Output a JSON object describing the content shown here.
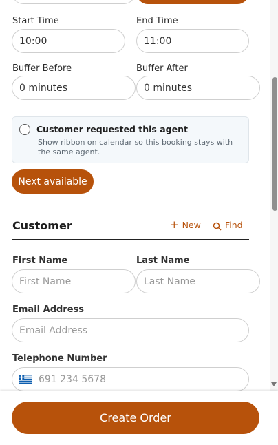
{
  "schedule": {
    "start_time": {
      "label": "Start Time",
      "value": "10:00"
    },
    "end_time": {
      "label": "End Time",
      "value": "11:00"
    },
    "buffer_before": {
      "label": "Buffer Before",
      "value": "0 minutes"
    },
    "buffer_after": {
      "label": "Buffer After",
      "value": "0 minutes"
    }
  },
  "agent_request": {
    "title": "Customer requested this agent",
    "description": "Show ribbon on calendar so this booking stays with the same agent."
  },
  "next_available_label": "Next available",
  "customer": {
    "heading": "Customer",
    "new_label": "New",
    "find_label": "Find",
    "first_name": {
      "label": "First Name",
      "placeholder": "First Name"
    },
    "last_name": {
      "label": "Last Name",
      "placeholder": "Last Name"
    },
    "email": {
      "label": "Email Address",
      "placeholder": "Email Address"
    },
    "phone": {
      "label": "Telephone Number",
      "placeholder": "691 234 5678"
    }
  },
  "create_order_label": "Create Order",
  "colors": {
    "accent": "#b7520b",
    "border": "#cfcfcf",
    "panel_bg": "#f4f8fb"
  },
  "icons": {
    "new": "plus-icon",
    "find": "search-icon",
    "flag": "greece-flag-icon"
  }
}
